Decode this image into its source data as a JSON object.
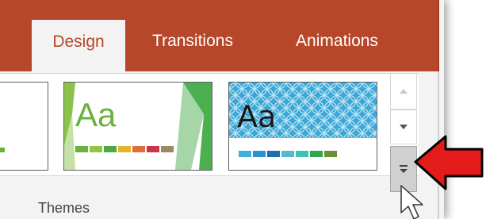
{
  "tabs": [
    {
      "label": "Design",
      "active": true
    },
    {
      "label": "Transitions",
      "active": false
    },
    {
      "label": "Animations",
      "active": false
    }
  ],
  "themes": {
    "group_label": "Themes",
    "items": [
      {
        "preview_text": "Aa",
        "swatches": [
          "#6bb13e",
          "#91c63f",
          "#4faa43",
          "#e3b527",
          "#e16e36",
          "#c9354b",
          "#9b8a63"
        ]
      },
      {
        "preview_text": "Aa",
        "swatches": [
          "#3bb0e0",
          "#2d8fd4",
          "#1f6fb0",
          "#5ab7d3",
          "#3fc1b0",
          "#2fa64f",
          "#6c8f36"
        ]
      }
    ]
  },
  "colors": {
    "tab_bar": "#b7472a",
    "active_tab_text": "#b7472a",
    "ribbon": "#f3f3f3",
    "callout_arrow": "#e31b1b"
  },
  "icons": {
    "scroll_up": "chevron-up-icon",
    "scroll_down": "chevron-down-icon",
    "more": "more-dropdown-icon",
    "pointer": "mouse-pointer-icon",
    "callout": "red-arrow-icon"
  }
}
